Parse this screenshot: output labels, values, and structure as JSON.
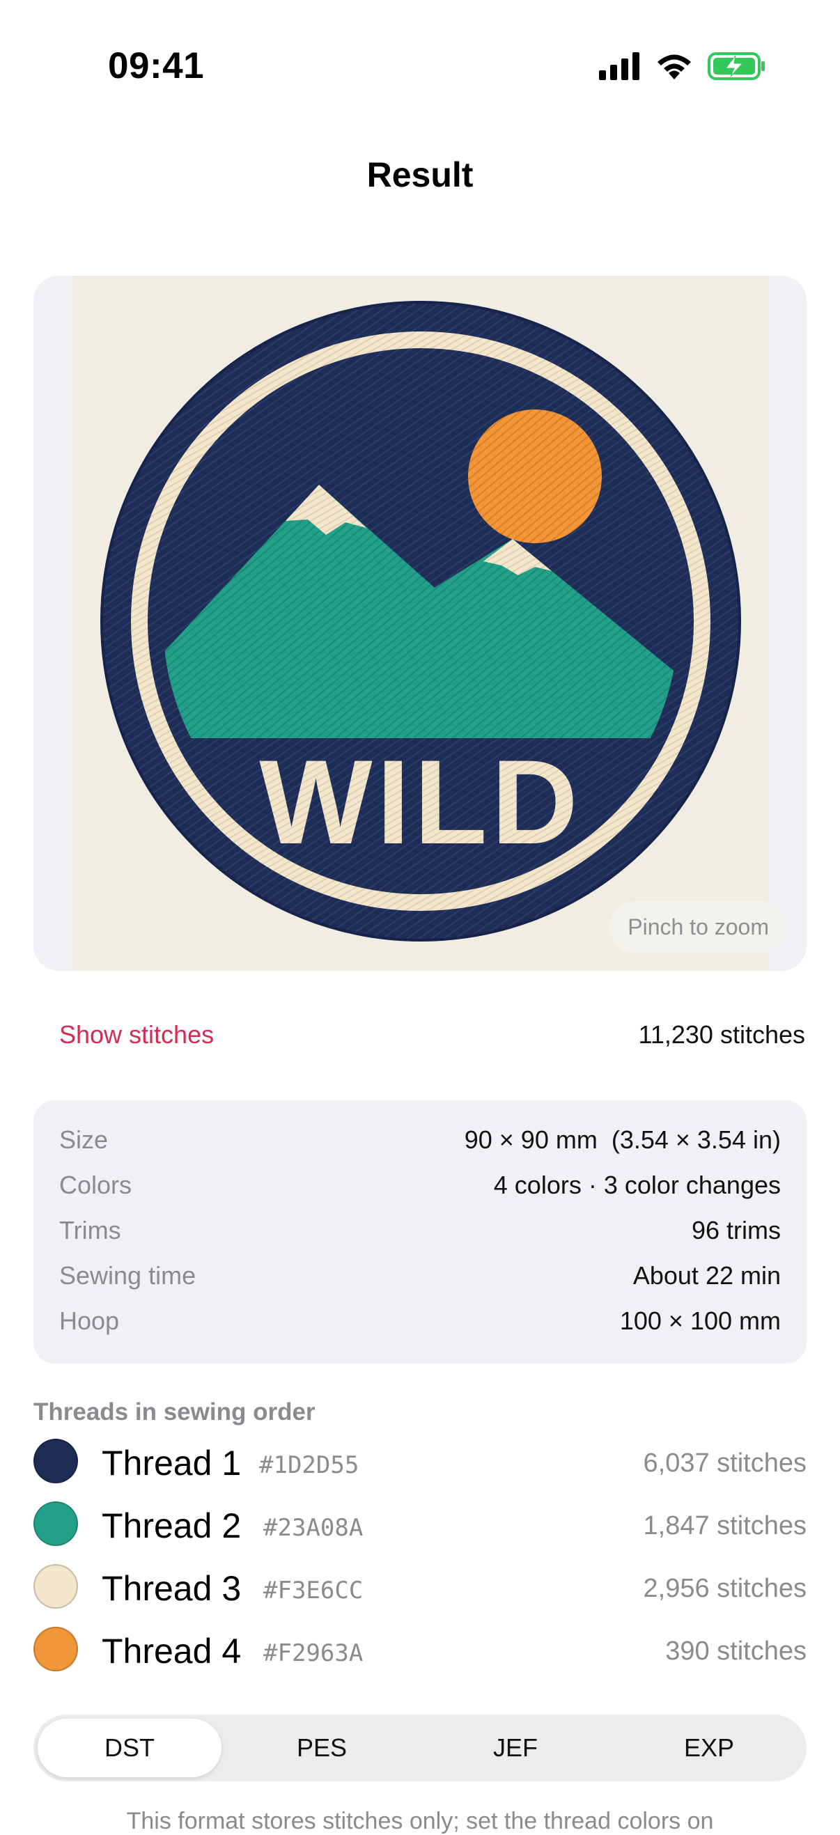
{
  "status_bar": {
    "time": "09:41",
    "icons": [
      "cellular-signal-icon",
      "wifi-icon",
      "battery-charging-icon"
    ]
  },
  "header": {
    "title": "Result"
  },
  "preview": {
    "patch_text": "WILD",
    "zoom_hint": "Pinch to zoom"
  },
  "stitches_row": {
    "toggle_label": "Show stitches",
    "total": "11,230 stitches"
  },
  "info": {
    "rows": [
      {
        "label": "Size",
        "value": "90 × 90 mm  (3.54 × 3.54 in)"
      },
      {
        "label": "Colors",
        "value": "4 colors · 3 color changes"
      },
      {
        "label": "Trims",
        "value": "96 trims"
      },
      {
        "label": "Sewing time",
        "value": "About 22 min"
      },
      {
        "label": "Hoop",
        "value": "100 × 100 mm"
      }
    ]
  },
  "threads": {
    "heading": "Threads in sewing order",
    "items": [
      {
        "name": "Thread 1",
        "hex": "#1D2D55",
        "stitches": "6,037 stitches",
        "color": "#1D2D55"
      },
      {
        "name": "Thread 2",
        "hex": "#23A08A",
        "stitches": "1,847 stitches",
        "color": "#23A08A"
      },
      {
        "name": "Thread 3",
        "hex": "#F3E6CC",
        "stitches": "2,956 stitches",
        "color": "#F3E6CC"
      },
      {
        "name": "Thread 4",
        "hex": "#F2963A",
        "stitches": "390 stitches",
        "color": "#F2963A"
      }
    ]
  },
  "formats": {
    "options": [
      "DST",
      "PES",
      "JEF",
      "EXP"
    ],
    "selected": "DST"
  },
  "footnote": "This format stores stitches only; set the thread colors on",
  "colors": {
    "accent": "#D22C52",
    "card_bg": "#F1F1F5",
    "patch_bg": "#F2EDE3",
    "battery_green": "#34C759"
  }
}
